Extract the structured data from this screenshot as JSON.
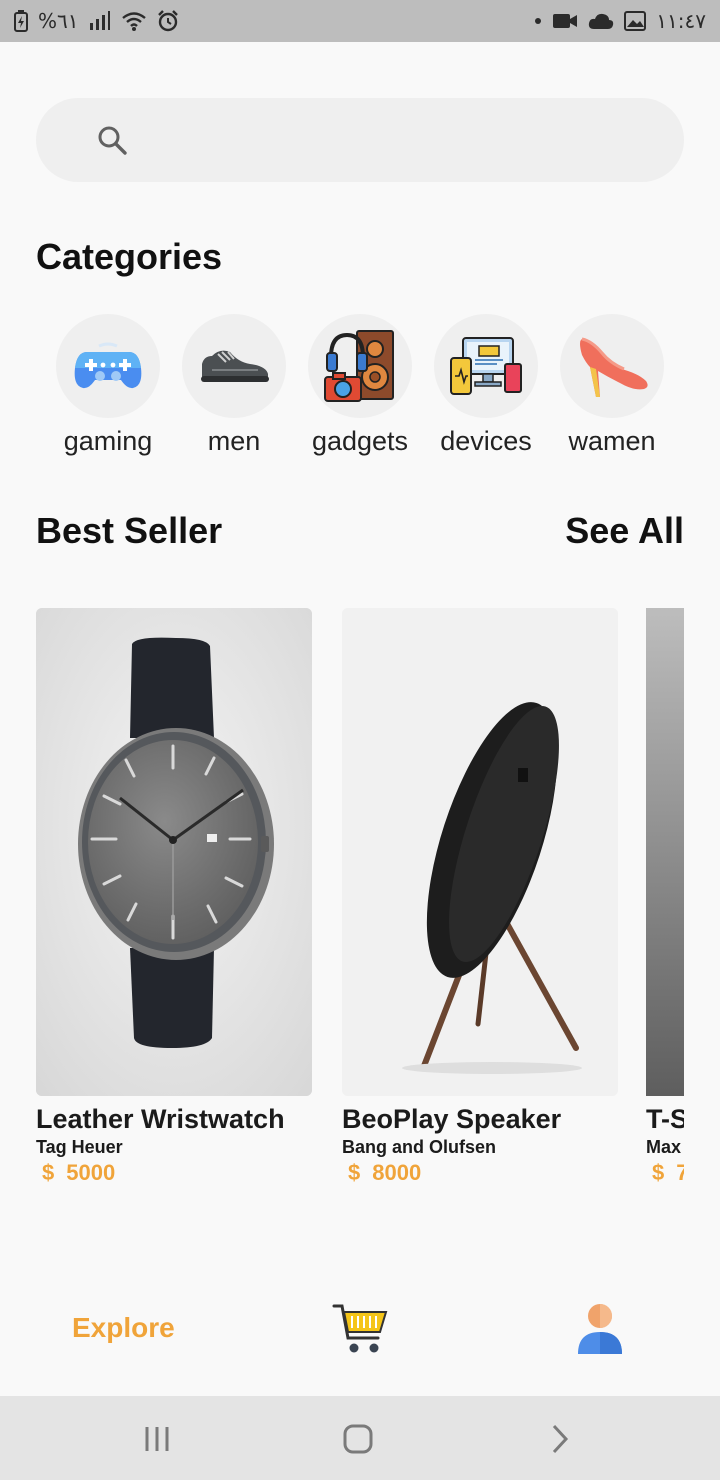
{
  "status_bar": {
    "battery_text": "%٦١",
    "time": "١١:٤٧"
  },
  "search": {
    "placeholder": ""
  },
  "categories": {
    "title": "Categories",
    "items": [
      {
        "label": "gaming",
        "icon": "gamepad-icon"
      },
      {
        "label": "men",
        "icon": "sneaker-icon"
      },
      {
        "label": "gadgets",
        "icon": "gadgets-icon"
      },
      {
        "label": "devices",
        "icon": "devices-icon"
      },
      {
        "label": "wamen",
        "icon": "high-heel-icon"
      }
    ]
  },
  "best_seller": {
    "title": "Best Seller",
    "see_all": "See All",
    "products": [
      {
        "name": "Leather Wristwatch",
        "brand": "Tag Heuer",
        "currency": "$",
        "price": "5000"
      },
      {
        "name": "BeoPlay Speaker",
        "brand": "Bang and Olufsen",
        "currency": "$",
        "price": "8000"
      },
      {
        "name": "T-S",
        "brand": "Max",
        "currency": "$",
        "price": "7"
      }
    ]
  },
  "bottom_nav": {
    "explore": "Explore"
  },
  "colors": {
    "accent": "#f0a43a",
    "background": "#f9f9f9",
    "search_bg": "#efefef"
  }
}
